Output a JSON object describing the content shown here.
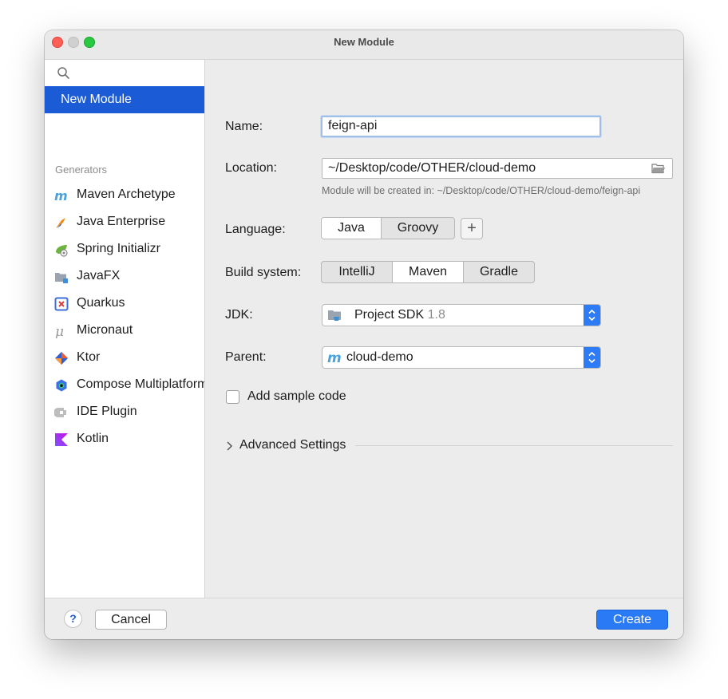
{
  "window": {
    "title": "New Module"
  },
  "sidebar": {
    "selected_label": "New Module",
    "generators_header": "Generators",
    "items": [
      {
        "label": "Maven Archetype",
        "icon": "maven-icon"
      },
      {
        "label": "Java Enterprise",
        "icon": "java-enterprise-icon"
      },
      {
        "label": "Spring Initializr",
        "icon": "spring-icon"
      },
      {
        "label": "JavaFX",
        "icon": "javafx-icon"
      },
      {
        "label": "Quarkus",
        "icon": "quarkus-icon"
      },
      {
        "label": "Micronaut",
        "icon": "micronaut-icon"
      },
      {
        "label": "Ktor",
        "icon": "ktor-icon"
      },
      {
        "label": "Compose Multiplatform",
        "icon": "compose-icon"
      },
      {
        "label": "IDE Plugin",
        "icon": "ide-plugin-icon"
      },
      {
        "label": "Kotlin",
        "icon": "kotlin-icon"
      }
    ]
  },
  "form": {
    "name_label": "Name:",
    "name_value": "feign-api",
    "location_label": "Location:",
    "location_value": "~/Desktop/code/OTHER/cloud-demo",
    "location_hint": "Module will be created in: ~/Desktop/code/OTHER/cloud-demo/feign-api",
    "language_label": "Language:",
    "language_options": [
      "Java",
      "Groovy"
    ],
    "language_selected": "Java",
    "add_language_label": "+",
    "build_label": "Build system:",
    "build_options": [
      "IntelliJ",
      "Maven",
      "Gradle"
    ],
    "build_selected": "Maven",
    "jdk_label": "JDK:",
    "jdk_value": "Project SDK",
    "jdk_version": "1.8",
    "parent_label": "Parent:",
    "parent_value": "cloud-demo",
    "sample_code_label": "Add sample code",
    "sample_code_checked": false,
    "advanced_label": "Advanced Settings"
  },
  "footer": {
    "help_label": "?",
    "cancel_label": "Cancel",
    "create_label": "Create"
  },
  "colors": {
    "accent": "#1b5bd6",
    "primary_button": "#2a7af5",
    "close": "#fe5f57",
    "zoom": "#28c840"
  }
}
